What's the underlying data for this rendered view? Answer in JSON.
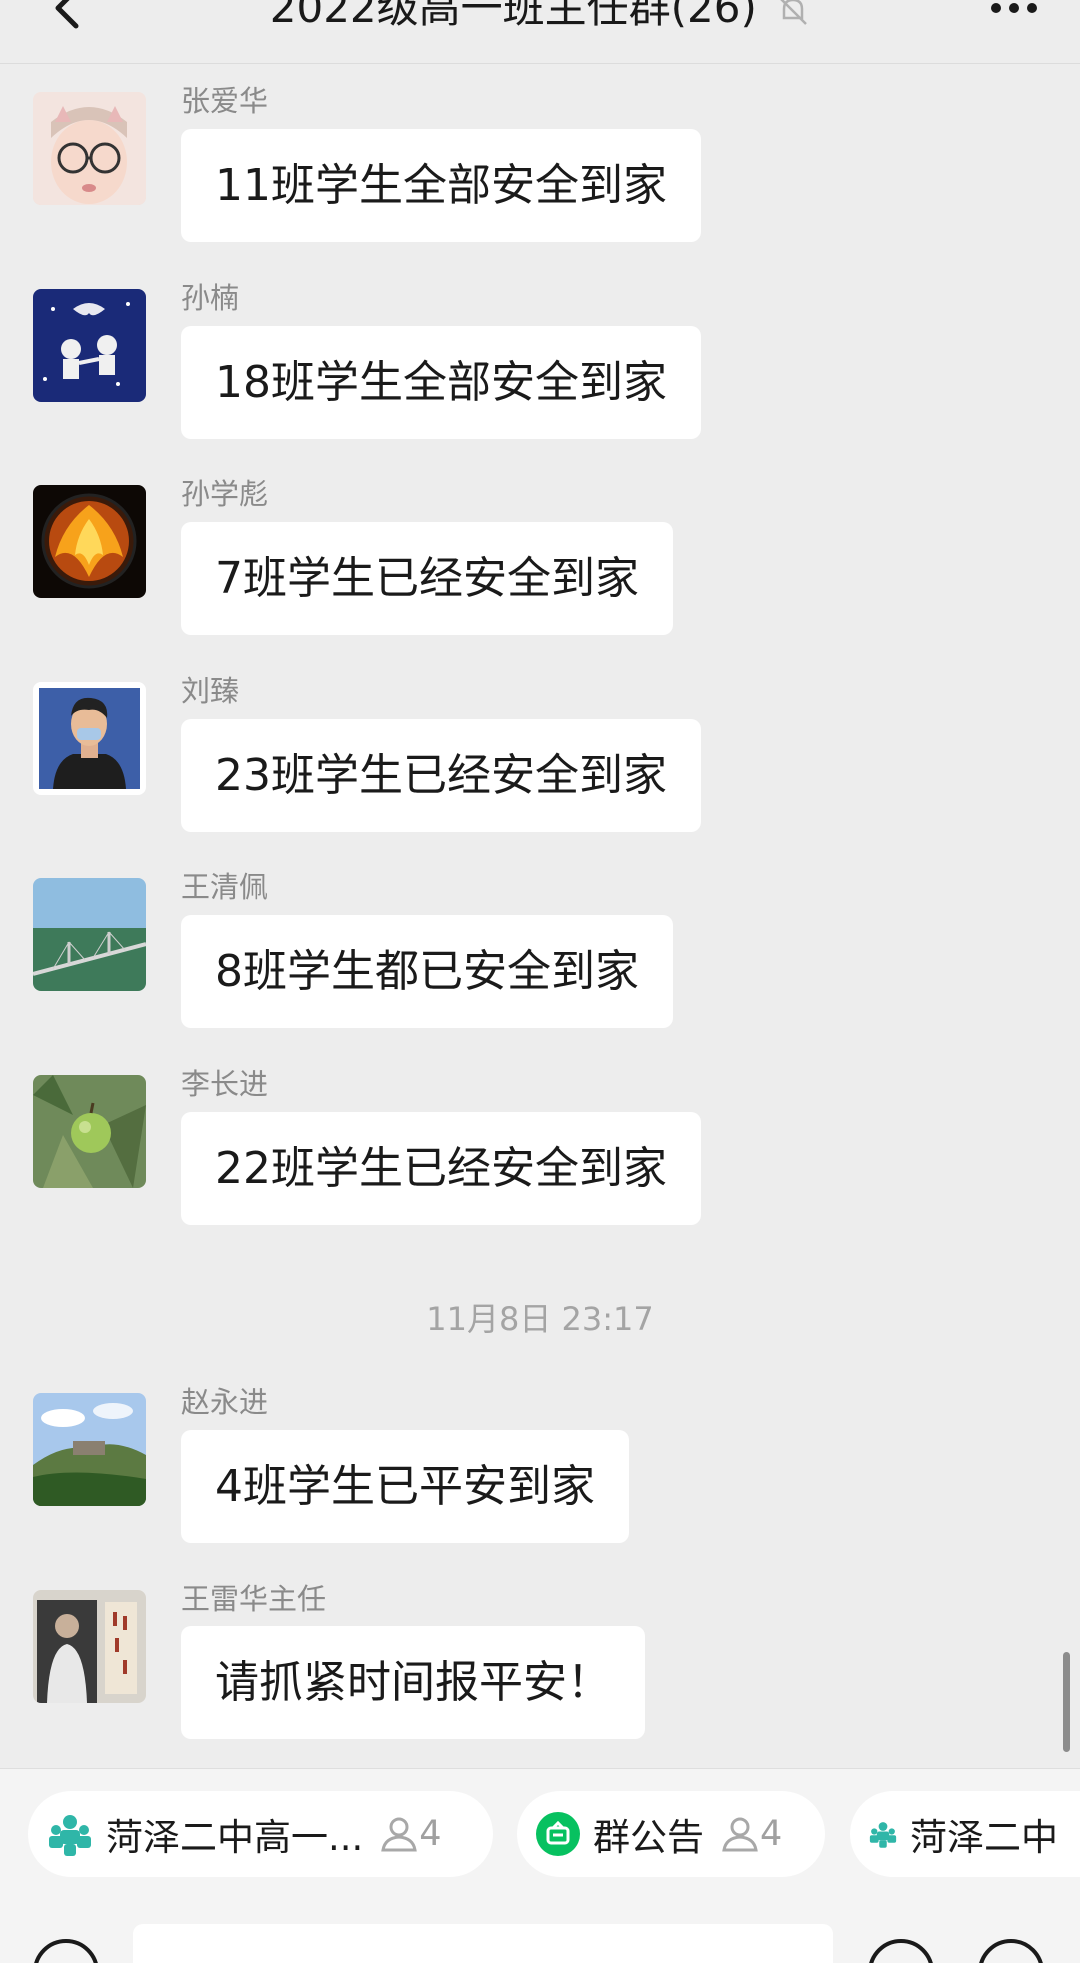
{
  "header": {
    "title": "2022级高一班主任群(26)",
    "back_icon": "chevron-left-icon",
    "mute_icon": "bell-off-icon",
    "more_icon": "more-dots-icon"
  },
  "messages": [
    {
      "sender": "张爱华",
      "text": "11班学生全部安全到家",
      "avatar": "baby-photo"
    },
    {
      "sender": "孙楠",
      "text": "18班学生全部安全到家",
      "avatar": "cartoon-astronauts"
    },
    {
      "sender": "孙学彪",
      "text": "7班学生已经安全到家",
      "avatar": "phoenix-emblem"
    },
    {
      "sender": "刘臻",
      "text": "23班学生已经安全到家",
      "avatar": "cartoon-man"
    },
    {
      "sender": "王清佩",
      "text": "8班学生都已安全到家",
      "avatar": "bridge-over-sea"
    },
    {
      "sender": "李长进",
      "text": "22班学生已经安全到家",
      "avatar": "green-apple"
    },
    {
      "sender": "赵永进",
      "text": "4班学生已平安到家",
      "avatar": "mountain-landscape"
    },
    {
      "sender": "王雷华主任",
      "text": "请抓紧时间报平安！",
      "avatar": "portrait-photo"
    }
  ],
  "timestamp": "11月8日 23:17",
  "shortcuts": [
    {
      "label": "菏泽二中高一...",
      "count": "4",
      "icon": "group-icon"
    },
    {
      "label": "群公告",
      "count": "4",
      "icon": "announcement-icon"
    },
    {
      "label": "菏泽二中",
      "icon": "group-icon"
    }
  ],
  "colors": {
    "background": "#ededed",
    "bubble": "#ffffff",
    "accent_green": "#07c160",
    "group_teal": "#2fb6a8"
  }
}
